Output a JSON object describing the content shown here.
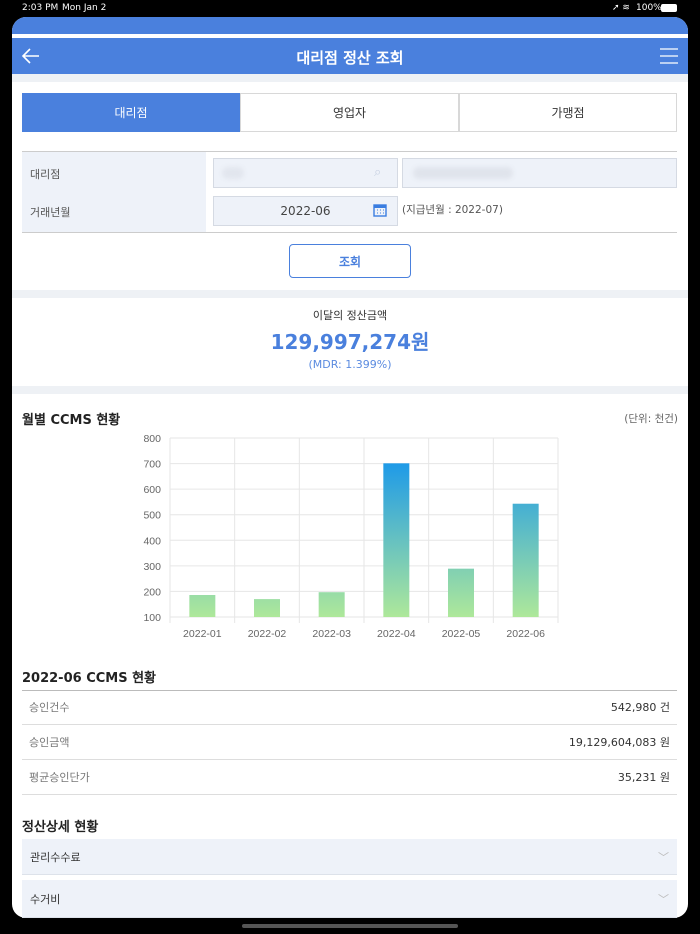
{
  "status_bar": {
    "time": "2:03 PM",
    "date": "Mon Jan 2",
    "battery": "100%"
  },
  "header": {
    "title": "대리점 정산 조회"
  },
  "tabs": [
    {
      "label": "대리점",
      "active": true
    },
    {
      "label": "영업자",
      "active": false
    },
    {
      "label": "가맹점",
      "active": false
    }
  ],
  "form": {
    "agency_label": "대리점",
    "period_label": "거래년월",
    "period_value": "2022-06",
    "pay_month_note": "(지급년월 : 2022-07)",
    "search_button": "조회"
  },
  "summary": {
    "label": "이달의 정산금액",
    "amount": "129,997,274원",
    "mdr": "(MDR: 1.399%)"
  },
  "chart_section": {
    "title": "월별 CCMS 현황",
    "unit": "(단위: 천건)"
  },
  "chart_data": {
    "type": "bar",
    "categories": [
      "2022-01",
      "2022-02",
      "2022-03",
      "2022-04",
      "2022-05",
      "2022-06"
    ],
    "values": [
      186,
      170,
      197,
      701,
      289,
      543
    ],
    "ylim": [
      100,
      800
    ],
    "yticks": [
      100,
      200,
      300,
      400,
      500,
      600,
      700,
      800
    ],
    "grid": true,
    "colors": {
      "top": "#1e9ae8",
      "bottom": "#aee89a"
    }
  },
  "ccms": {
    "title": "2022-06 CCMS 현황",
    "rows": [
      {
        "label": "승인건수",
        "value": "542,980 건"
      },
      {
        "label": "승인금액",
        "value": "19,129,604,083 원"
      },
      {
        "label": "평균승인단가",
        "value": "35,231 원"
      }
    ]
  },
  "detail": {
    "title": "정산상세 현황",
    "items": [
      {
        "label": "관리수수료"
      },
      {
        "label": "수거비"
      }
    ]
  },
  "colors": {
    "primary": "#4a80dd"
  }
}
